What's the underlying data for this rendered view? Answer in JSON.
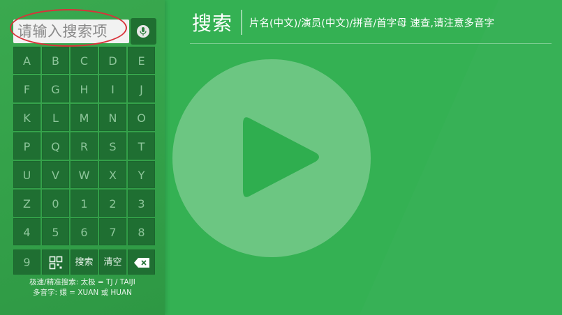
{
  "search": {
    "placeholder": "请输入搜索项",
    "mic_icon": "mic-icon"
  },
  "keyboard": {
    "rows": [
      [
        "A",
        "B",
        "C",
        "D",
        "E"
      ],
      [
        "F",
        "G",
        "H",
        "I",
        "J"
      ],
      [
        "K",
        "L",
        "M",
        "N",
        "O"
      ],
      [
        "P",
        "Q",
        "R",
        "S",
        "T"
      ],
      [
        "U",
        "V",
        "W",
        "X",
        "Y"
      ],
      [
        "Z",
        "0",
        "1",
        "2",
        "3"
      ],
      [
        "4",
        "5",
        "6",
        "7",
        "8"
      ]
    ],
    "last_row": {
      "nine": "9",
      "qr_icon": "qr-code-icon",
      "search_label": "搜索",
      "clear_label": "清空",
      "backspace_icon": "backspace-icon"
    }
  },
  "hints": {
    "line1": "极速/精准搜索: 太极 = TJ / TAIJI",
    "line2": "多音字: 嬛 = XUAN 或 HUAN"
  },
  "header": {
    "title": "搜索",
    "subtitle": "片名(中文)/演员(中文)/拼音/首字母 速查,请注意多音字"
  },
  "main": {
    "play_icon": "play-icon"
  },
  "colors": {
    "background": "#2fae4f",
    "key_bg": "#1f6f32",
    "annotation": "#d9323a"
  }
}
